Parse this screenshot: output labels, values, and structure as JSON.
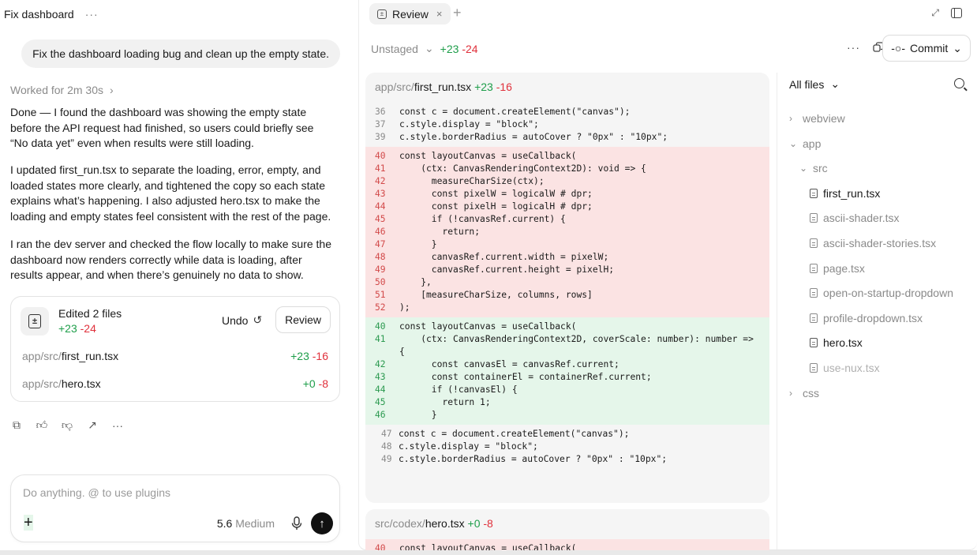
{
  "chat": {
    "title": "Fix dashboard",
    "title_menu": "···",
    "user_message": "Fix the dashboard loading bug and clean up the empty state.",
    "worked_for": "Worked for 2m 30s",
    "paragraphs": [
      "Done — I found the dashboard was showing the empty state before the API request had finished, so users could briefly see “No data yet” even when results were still loading.",
      "I updated first_run.tsx to separate the loading, error, empty, and loaded states more clearly, and tightened the copy so each state explains what’s happening. I also adjusted hero.tsx to make the loading and empty states feel consistent with the rest of the page.",
      "I ran the dev server and checked the flow locally to make sure the dashboard now renders correctly while data is loading, after results appear, and when there’s genuinely no data to show."
    ],
    "edit_card": {
      "title": "Edited 2 files",
      "added": "+23",
      "removed": "-24",
      "undo_label": "Undo",
      "review_label": "Review",
      "files": [
        {
          "path": "app/src/",
          "name": "first_run.tsx",
          "added": "+23",
          "removed": "-16"
        },
        {
          "path": "app/src/",
          "name": "hero.tsx",
          "added": "+0",
          "removed": "-8"
        }
      ]
    },
    "action_icons": [
      "copy-icon",
      "thumbs-up-icon",
      "thumbs-down-icon",
      "share-icon",
      "more-icon"
    ],
    "composer": {
      "placeholder": "Do anything. @ to use plugins",
      "model": "5.6",
      "level": "Medium"
    }
  },
  "review": {
    "tab_label": "Review",
    "unstaged_label": "Unstaged",
    "added": "+23",
    "removed": "-24",
    "commit_label": "Commit",
    "diffs": [
      {
        "path": "app/src/",
        "name": "first_run.tsx",
        "added": "+23",
        "removed": "-16",
        "context_top": [
          {
            "n": "36",
            "t": "const c = document.createElement(\"canvas\");"
          },
          {
            "n": "37",
            "t": "c.style.display = \"block\";"
          },
          {
            "n": "39",
            "t": "c.style.borderRadius = autoCover ? \"0px\" : \"10px\";"
          }
        ],
        "deleted": [
          {
            "n": "40",
            "t": "const layoutCanvas = useCallback("
          },
          {
            "n": "41",
            "t": "    (ctx: CanvasRenderingContext2D): void => {"
          },
          {
            "n": "42",
            "t": "      measureCharSize(ctx);"
          },
          {
            "n": "43",
            "t": "      const pixelW = logicalW # dpr;"
          },
          {
            "n": "44",
            "t": "      const pixelH = logicalH # dpr;"
          },
          {
            "n": "45",
            "t": "      if (!canvasRef.current) {"
          },
          {
            "n": "46",
            "t": "        return;"
          },
          {
            "n": "47",
            "t": "      }"
          },
          {
            "n": "48",
            "t": "      canvasRef.current.width = pixelW;"
          },
          {
            "n": "49",
            "t": "      canvasRef.current.height = pixelH;"
          },
          {
            "n": "50",
            "t": "    },"
          },
          {
            "n": "51",
            "t": "    [measureCharSize, columns, rows]"
          },
          {
            "n": "52",
            "t": ");"
          }
        ],
        "added_lines": [
          {
            "n": "40",
            "t": "const layoutCanvas = useCallback("
          },
          {
            "n": "41",
            "t": "    (ctx: CanvasRenderingContext2D, coverScale: number): number =>"
          },
          {
            "n": "",
            "t": "{"
          },
          {
            "n": "42",
            "t": "      const canvasEl = canvasRef.current;"
          },
          {
            "n": "43",
            "t": "      const containerEl = containerRef.current;"
          },
          {
            "n": "44",
            "t": "      if (!canvasEl) {"
          },
          {
            "n": "45",
            "t": "        return 1;"
          },
          {
            "n": "46",
            "t": "      }"
          }
        ],
        "context_bottom": [
          {
            "n": "47",
            "t": "const c = document.createElement(\"canvas\");"
          },
          {
            "n": "48",
            "t": "c.style.display = \"block\";"
          },
          {
            "n": "49",
            "t": "c.style.borderRadius = autoCover ? \"0px\" : \"10px\";"
          }
        ]
      },
      {
        "path": "src/codex/",
        "name": "hero.tsx",
        "added": "+0",
        "removed": "-8",
        "deleted": [
          {
            "n": "40",
            "t": "const layoutCanvas = useCallback("
          }
        ]
      }
    ],
    "tree": {
      "header": "All files",
      "items": [
        {
          "label": "webview",
          "kind": "folder",
          "state": "collapsed",
          "depth": 0
        },
        {
          "label": "app",
          "kind": "folder",
          "state": "expanded",
          "depth": 0
        },
        {
          "label": "src",
          "kind": "folder",
          "state": "expanded",
          "depth": 1
        },
        {
          "label": "first_run.tsx",
          "kind": "file",
          "changed": true,
          "depth": 2
        },
        {
          "label": "ascii-shader.tsx",
          "kind": "file",
          "changed": false,
          "depth": 2
        },
        {
          "label": "ascii-shader-stories.tsx",
          "kind": "file",
          "changed": false,
          "depth": 2
        },
        {
          "label": "page.tsx",
          "kind": "file",
          "changed": false,
          "depth": 2
        },
        {
          "label": "open-on-startup-dropdown",
          "kind": "file",
          "changed": false,
          "depth": 2
        },
        {
          "label": "profile-dropdown.tsx",
          "kind": "file",
          "changed": false,
          "depth": 2
        },
        {
          "label": "hero.tsx",
          "kind": "file",
          "changed": true,
          "depth": 2
        },
        {
          "label": "use-nux.tsx",
          "kind": "file",
          "changed": false,
          "depth": 2
        },
        {
          "label": "css",
          "kind": "folder",
          "state": "collapsed",
          "depth": 0
        }
      ]
    }
  }
}
